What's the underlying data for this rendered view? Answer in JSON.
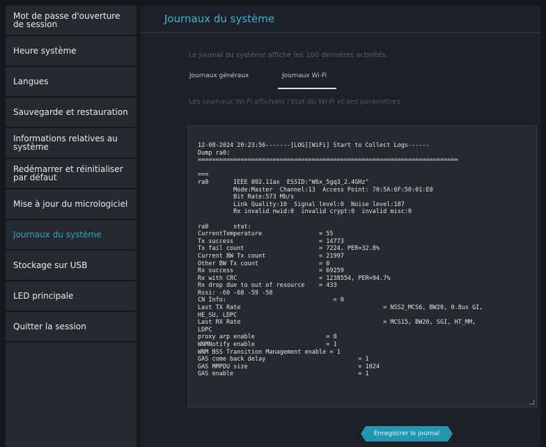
{
  "sidebar": {
    "items": [
      {
        "label": "Mot de passe d'ouverture de session",
        "active": false
      },
      {
        "label": "Heure système",
        "active": false
      },
      {
        "label": "Langues",
        "active": false
      },
      {
        "label": "Sauvegarde et restauration",
        "active": false
      },
      {
        "label": "Informations relatives au système",
        "active": false
      },
      {
        "label": "Redémarrer et réinitialiser par défaut",
        "active": false
      },
      {
        "label": "Mise à jour du micrologiciel",
        "active": false
      },
      {
        "label": "Journaux du système",
        "active": true
      },
      {
        "label": "Stockage sur USB",
        "active": false
      },
      {
        "label": "LED principale",
        "active": false
      },
      {
        "label": "Quitter la session",
        "active": false
      }
    ]
  },
  "main": {
    "title": "Journaux du système",
    "description": "Le journal du système affiche les 100 dernières activités.",
    "tabs": [
      {
        "label": "Journaux généraux",
        "selected": false
      },
      {
        "label": "Journaux Wi-Fi",
        "selected": true
      }
    ],
    "sub_description": "Les journaux Wi-Fi affichant l'état du Wi-Fi et ses paramètres",
    "log_lines": [
      "12-08-2024 20:23:56-------[LOG][WiFi] Start to Collect Logs------",
      "Dump ra0:",
      "=========================================================================",
      "",
      "===",
      "ra0       IEEE 802.11ax  ESSID:\"W6x_5gq3_2.4GHz\"",
      "          Mode:Master  Channel:13  Access Point: 70:5A:6F:50:01:E0",
      "          Bit Rate:573 Mb/s",
      "          Link Quality:10  Signal level:0  Noise level:187",
      "          Rx invalid nwid:0  invalid crypt:0  invalid misc:0",
      "",
      "ra0       stat:",
      "CurrentTemperature                = 55",
      "Tx success                        = 14773",
      "Tx fail count                     = 7224, PER=32.8%",
      "Current BW Tx count               = 21997",
      "Other BW Tx count                 = 0",
      "Rx success                        = 69259",
      "Rx with CRC                       = 1238554, PER=94.7%",
      "Rx drop due to out of resource    = 433",
      "Rssi: -60 -68 -59 -58",
      "CN Info:                              = 0",
      "Last TX Rate                                        = NSS2_MCS6, BW20, 0.8us GI,",
      "HE_SU, LDPC",
      "Last RX Rate                                        = MCS15, BW20, SGI, HT_MM,",
      "LDPC",
      "proxy arp enable                    = 0",
      "WNMNotify enable                    = 1",
      "WNM BSS Transition Management enable = 1",
      "GAS come back delay                          = 1",
      "GAS MMPDU size                               = 1024",
      "GAS enable                                   = 1"
    ],
    "save_button": "Enregistrer le journal"
  },
  "colors": {
    "accent": "#2aa6c4",
    "button": "#2296b3",
    "sidebar_bg": "#262a30",
    "main_bg": "#1d2127",
    "log_bg": "#252a31"
  }
}
